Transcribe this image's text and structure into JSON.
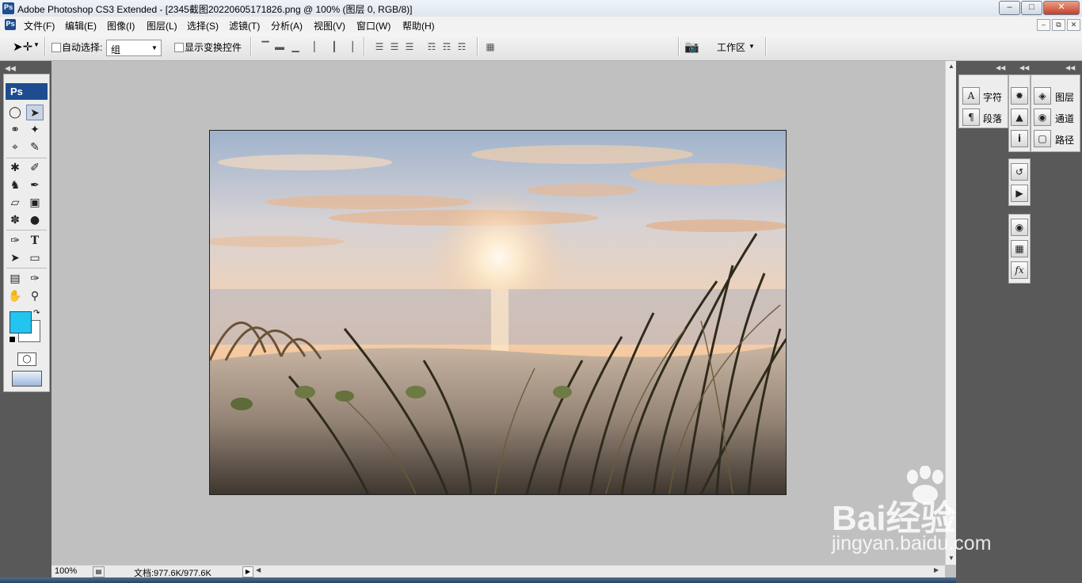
{
  "window": {
    "title": "Adobe Photoshop CS3 Extended - [2345截图20220605171826.png @ 100% (图层 0, RGB/8)]",
    "app_icon": "Ps"
  },
  "menu": {
    "items": [
      "文件(F)",
      "编辑(E)",
      "图像(I)",
      "图层(L)",
      "选择(S)",
      "滤镜(T)",
      "分析(A)",
      "视图(V)",
      "窗口(W)",
      "帮助(H)"
    ]
  },
  "options_bar": {
    "auto_select_label": "自动选择:",
    "auto_select_value": "组",
    "show_transform_label": "显示变换控件",
    "workspace_label": "工作区"
  },
  "toolbox": {
    "logo": "Ps",
    "foreground_color": "#22c4f0",
    "background_color": "#ffffff",
    "tools": [
      "marquee-tool",
      "move-tool",
      "lasso-tool",
      "magic-wand-tool",
      "crop-tool",
      "slice-tool",
      "spot-healing-tool",
      "brush-tool",
      "clone-stamp-tool",
      "history-brush-tool",
      "eraser-tool",
      "gradient-tool",
      "blur-tool",
      "dodge-tool",
      "pen-tool",
      "type-tool",
      "path-selection-tool",
      "shape-tool",
      "notes-tool",
      "eyedropper-tool",
      "hand-tool",
      "zoom-tool"
    ]
  },
  "status": {
    "zoom": "100%",
    "doc_info": "文档:977.6K/977.6K"
  },
  "panels": {
    "character": "字符",
    "paragraph": "段落",
    "layers": "图层",
    "channels": "通道",
    "paths": "路径"
  },
  "watermark": {
    "brand": "Bai经验",
    "url": "jingyan.baidu.com"
  }
}
